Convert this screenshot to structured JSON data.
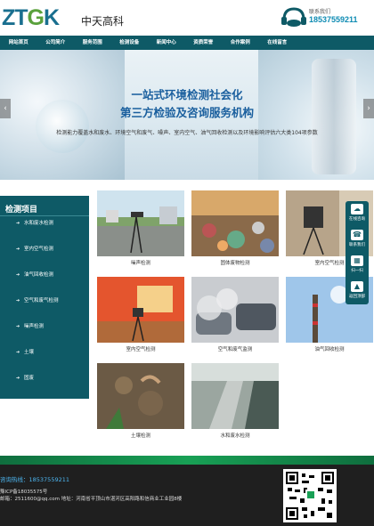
{
  "header": {
    "logo_text_a": "ZT",
    "logo_text_b": "G",
    "logo_text_c": "K",
    "company_name": "中天高科",
    "contact_label": "联系我们",
    "contact_phone": "18537559211"
  },
  "nav": {
    "items": [
      "网站首页",
      "公司简介",
      "服务范围",
      "检测设备",
      "新闻中心",
      "资质荣誉",
      "合作案例",
      "在线留言"
    ]
  },
  "banner": {
    "title_line1": "一站式环境检测社会化",
    "title_line2": "第三方检验及咨询服务机构",
    "description": "检测能力覆盖水和废水、环境空气和废气、噪声、室内空气、油气回收检测以及环境影响评估六大类104项参数",
    "prev_arrow": "‹",
    "next_arrow": "›"
  },
  "sidebar": {
    "title": "检测项目",
    "items": [
      "水和废水检测",
      "室内空气检测",
      "油气回收检测",
      "空气和废气检测",
      "噪声检测",
      "土壤",
      "固废"
    ]
  },
  "products": [
    {
      "caption": "噪声检测"
    },
    {
      "caption": "固体废物检测"
    },
    {
      "caption": "室内空气检测"
    },
    {
      "caption": "室内空气检测"
    },
    {
      "caption": "空气和废气监测"
    },
    {
      "caption": "油气回收检测"
    },
    {
      "caption": "土壤检测"
    },
    {
      "caption": "水和废水检测"
    }
  ],
  "float_panel": {
    "items": [
      {
        "label": "在线咨询",
        "icon": "chat-icon",
        "glyph": "☁"
      },
      {
        "label": "联系我们",
        "icon": "phone-icon",
        "glyph": "☎"
      },
      {
        "label": "扫一扫",
        "icon": "qrcode-icon",
        "glyph": "▦"
      },
      {
        "label": "返回顶部",
        "icon": "arrow-up-icon",
        "glyph": "▲"
      }
    ]
  },
  "footer": {
    "hotline": "咨询热线：18537559211",
    "icp": "豫ICP备18035575号",
    "mail_address": "邮箱：2511600@qq.com 地址：河南省平顶山市湛河区高阳路和信商业工业园8楼",
    "qr_caption": "扫一扫"
  },
  "colors": {
    "brand_teal": "#0e5a66",
    "logo_blue": "#1a6f8f",
    "logo_green": "#5aa13c",
    "phone_blue": "#0e8bb3",
    "banner_title": "#1a5f9e",
    "footer_dark": "#1f1f1f",
    "footer_stripe": "#18a055"
  }
}
